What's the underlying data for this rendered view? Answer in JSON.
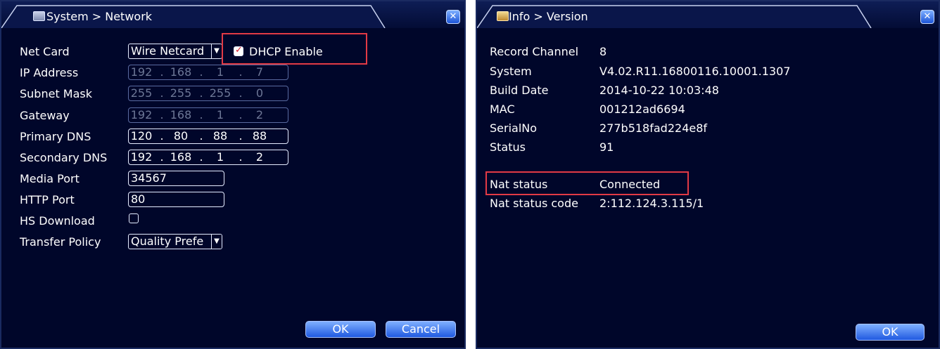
{
  "network": {
    "title": "System > Network",
    "labels": {
      "net_card": "Net Card",
      "ip_address": "IP Address",
      "subnet_mask": "Subnet Mask",
      "gateway": "Gateway",
      "primary_dns": "Primary DNS",
      "secondary_dns": "Secondary DNS",
      "media_port": "Media Port",
      "http_port": "HTTP Port",
      "hs_download": "HS Download",
      "transfer_policy": "Transfer Policy"
    },
    "net_card_value": "Wire Netcard",
    "dhcp_label": "DHCP Enable",
    "dhcp_checked": true,
    "ip_address": [
      "192",
      "168",
      "1",
      "7"
    ],
    "subnet_mask": [
      "255",
      "255",
      "255",
      "0"
    ],
    "gateway": [
      "192",
      "168",
      "1",
      "2"
    ],
    "primary_dns": [
      "120",
      "80",
      "88",
      "88"
    ],
    "secondary_dns": [
      "192",
      "168",
      "1",
      "2"
    ],
    "ip_separator": ".",
    "media_port": "34567",
    "http_port": "80",
    "hs_download_checked": false,
    "transfer_policy_value": "Quality Prefe",
    "ok_label": "OK",
    "cancel_label": "Cancel"
  },
  "version": {
    "title": "Info > Version",
    "rows": [
      {
        "label": "Record Channel",
        "value": "8"
      },
      {
        "label": "System",
        "value": "V4.02.R11.16800116.10001.1307"
      },
      {
        "label": "Build Date",
        "value": "2014-10-22 10:03:48"
      },
      {
        "label": "MAC",
        "value": "001212ad6694"
      },
      {
        "label": "SerialNo",
        "value": "277b518fad224e8f"
      },
      {
        "label": "Status",
        "value": "91"
      }
    ],
    "nat_rows": [
      {
        "label": "Nat status",
        "value": "Connected"
      },
      {
        "label": "Nat status code",
        "value": "2:112.124.3.115/1"
      }
    ],
    "ok_label": "OK"
  },
  "colors": {
    "window_bg": "#00062a",
    "highlight": "#e23a45",
    "button": "#2059e0"
  },
  "icons": {
    "network_title": "settings-window-icon",
    "version_title": "info-window-icon",
    "close": "close-icon"
  }
}
